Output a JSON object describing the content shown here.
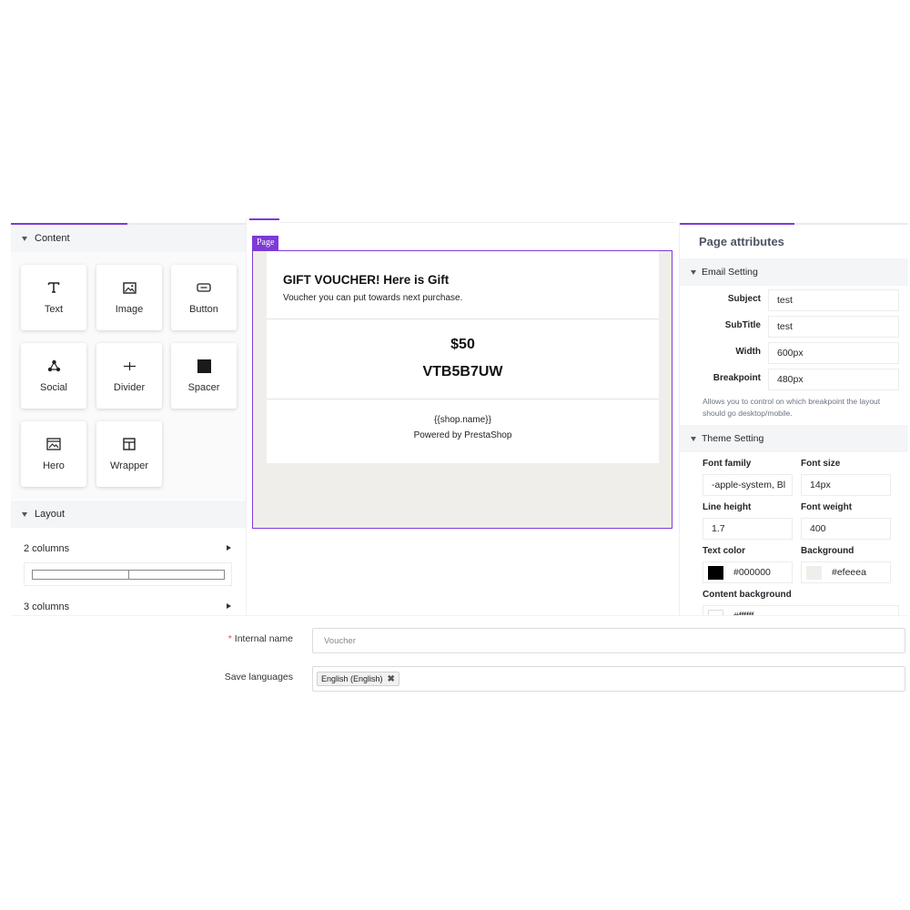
{
  "left_panel": {
    "content_header": "Content",
    "blocks": [
      {
        "label": "Text",
        "icon": "text-icon"
      },
      {
        "label": "Image",
        "icon": "image-icon"
      },
      {
        "label": "Button",
        "icon": "button-icon"
      },
      {
        "label": "Social",
        "icon": "social-icon"
      },
      {
        "label": "Divider",
        "icon": "divider-icon"
      },
      {
        "label": "Spacer",
        "icon": "spacer-icon"
      },
      {
        "label": "Hero",
        "icon": "hero-icon"
      },
      {
        "label": "Wrapper",
        "icon": "wrapper-icon"
      }
    ],
    "layout_header": "Layout",
    "layout_items": [
      {
        "label": "2 columns"
      },
      {
        "label": "3 columns"
      }
    ]
  },
  "canvas": {
    "page_label": "Page",
    "email": {
      "title": "GIFT VOUCHER! Here is Gift",
      "subtitle": "Voucher you can put towards next purchase.",
      "amount": "$50",
      "code": "VTB5B7UW",
      "shop_name": "{{shop.name}}",
      "powered_by": "Powered by PrestaShop"
    }
  },
  "right_panel": {
    "title": "Page attributes",
    "email_setting": {
      "header": "Email Setting",
      "fields": [
        {
          "label": "Subject",
          "value": "test"
        },
        {
          "label": "SubTitle",
          "value": "test"
        },
        {
          "label": "Width",
          "value": "600px"
        },
        {
          "label": "Breakpoint",
          "value": "480px"
        }
      ],
      "help": "Allows you to control on which breakpoint the layout should go desktop/mobile."
    },
    "theme_setting": {
      "header": "Theme Setting",
      "font_family_label": "Font family",
      "font_family_value": "-apple-system, Bl",
      "font_size_label": "Font size",
      "font_size_value": "14px",
      "line_height_label": "Line height",
      "line_height_value": "1.7",
      "font_weight_label": "Font weight",
      "font_weight_value": "400",
      "text_color_label": "Text color",
      "text_color_value": "#000000",
      "background_label": "Background",
      "background_value": "#efeeea",
      "content_background_label": "Content background",
      "content_background_value": "#ffffff"
    }
  },
  "form": {
    "internal_name_label": "Internal name",
    "internal_name_placeholder": "Voucher",
    "save_languages_label": "Save languages",
    "languages": [
      "English (English)"
    ]
  },
  "colors": {
    "accent": "#7d3bd6",
    "canvas_bg": "#efeeea",
    "text_color_swatch": "#000000",
    "background_swatch": "#efeeea"
  }
}
